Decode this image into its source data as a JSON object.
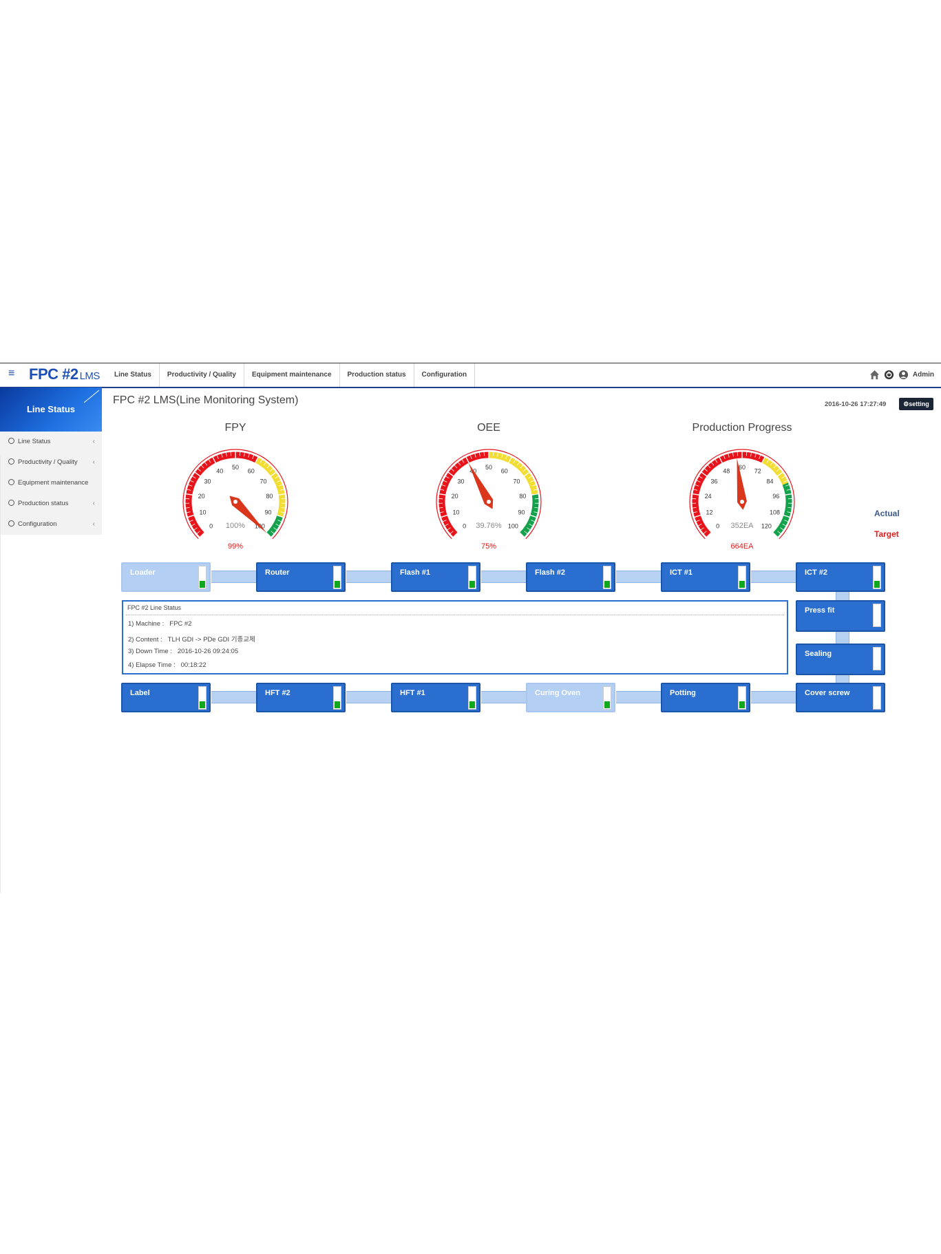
{
  "app": {
    "logo_main": "FPC #2",
    "logo_sub": "LMS"
  },
  "nav": [
    "Line Status",
    "Productivity / Quality",
    "Equipment maintenance",
    "Production status",
    "Configuration"
  ],
  "user": {
    "name": "Admin"
  },
  "sidebar": {
    "header": "Line Status",
    "items": [
      {
        "label": "Line Status",
        "arrow": "‹"
      },
      {
        "label": "Productivity / Quality",
        "arrow": "‹"
      },
      {
        "label": "Equipment maintenance",
        "arrow": ""
      },
      {
        "label": "Production status",
        "arrow": "‹"
      },
      {
        "label": "Configuration",
        "arrow": "‹"
      }
    ]
  },
  "page": {
    "title": "FPC #2 LMS(Line Monitoring System)",
    "datetime": "2016-10-26 17:27:49",
    "setting_label": "setting"
  },
  "gauges": [
    {
      "title": "FPY",
      "ticks": [
        "0",
        "10",
        "20",
        "30",
        "40",
        "50",
        "60",
        "70",
        "80",
        "90",
        "100"
      ],
      "max": 100,
      "value": 100,
      "actual_label": "100%",
      "target_label": "99%",
      "bands": [
        {
          "from": 0,
          "to": 0.6,
          "color": "#e8141c"
        },
        {
          "from": 0.6,
          "to": 0.9,
          "color": "#f1dd33"
        },
        {
          "from": 0.9,
          "to": 1,
          "color": "#14a14b"
        }
      ]
    },
    {
      "title": "OEE",
      "ticks": [
        "0",
        "10",
        "20",
        "30",
        "40",
        "50",
        "60",
        "70",
        "80",
        "90",
        "100"
      ],
      "max": 100,
      "value": 39.76,
      "actual_label": "39.76%",
      "target_label": "75%",
      "bands": [
        {
          "from": 0,
          "to": 0.5,
          "color": "#e8141c"
        },
        {
          "from": 0.5,
          "to": 0.8,
          "color": "#f1dd33"
        },
        {
          "from": 0.8,
          "to": 1,
          "color": "#14a14b"
        }
      ]
    },
    {
      "title": "Production Progress",
      "ticks": [
        "0",
        "12",
        "24",
        "36",
        "48",
        "60",
        "72",
        "84",
        "96",
        "108",
        "120"
      ],
      "max": 120,
      "value": 57,
      "actual_label": "352EA",
      "target_label": "664EA",
      "bands": [
        {
          "from": 0,
          "to": 0.6,
          "color": "#e8141c"
        },
        {
          "from": 0.6,
          "to": 0.75,
          "color": "#f1dd33"
        },
        {
          "from": 0.75,
          "to": 1,
          "color": "#14a14b"
        }
      ]
    }
  ],
  "legend": {
    "actual": "Actual",
    "target": "Target"
  },
  "machines": [
    {
      "name": "Loader",
      "level": 0.3,
      "active": false
    },
    {
      "name": "Router",
      "level": 0.3,
      "active": true
    },
    {
      "name": "Flash #1",
      "level": 0.3,
      "active": true
    },
    {
      "name": "Flash #2",
      "level": 0.3,
      "active": true
    },
    {
      "name": "ICT #1",
      "level": 0.3,
      "active": true
    },
    {
      "name": "ICT #2",
      "level": 0.3,
      "active": true
    },
    {
      "name": "Press fit",
      "level": 0,
      "active": true
    },
    {
      "name": "Sealing",
      "level": 0,
      "active": true
    },
    {
      "name": "Cover screw",
      "level": 0,
      "active": true
    },
    {
      "name": "Potting",
      "level": 0.3,
      "active": true
    },
    {
      "name": "Curing Oven",
      "level": 0.3,
      "active": false
    },
    {
      "name": "HFT #1",
      "level": 0.3,
      "active": true
    },
    {
      "name": "HFT #2",
      "level": 0.3,
      "active": true
    },
    {
      "name": "Label",
      "level": 0.3,
      "active": true
    }
  ],
  "line_status": {
    "header": "FPC #2 Line Status",
    "rows": [
      {
        "label": "1) Machine :",
        "value": "FPC #2"
      },
      {
        "label": "2) Content :",
        "value": "TLH GDI -> PDe GDI 기종교체"
      },
      {
        "label": "3) Down Time :",
        "value": "2016-10-26 09:24:05"
      },
      {
        "label": "4) Elapse Time :",
        "value": "00:18:22"
      }
    ]
  },
  "colors": {
    "accent": "#1d4fb7",
    "machine": "#2a6fd0",
    "machine_idle": "#b3cff4",
    "ok": "#10a81d",
    "needle": "#d9361b"
  }
}
